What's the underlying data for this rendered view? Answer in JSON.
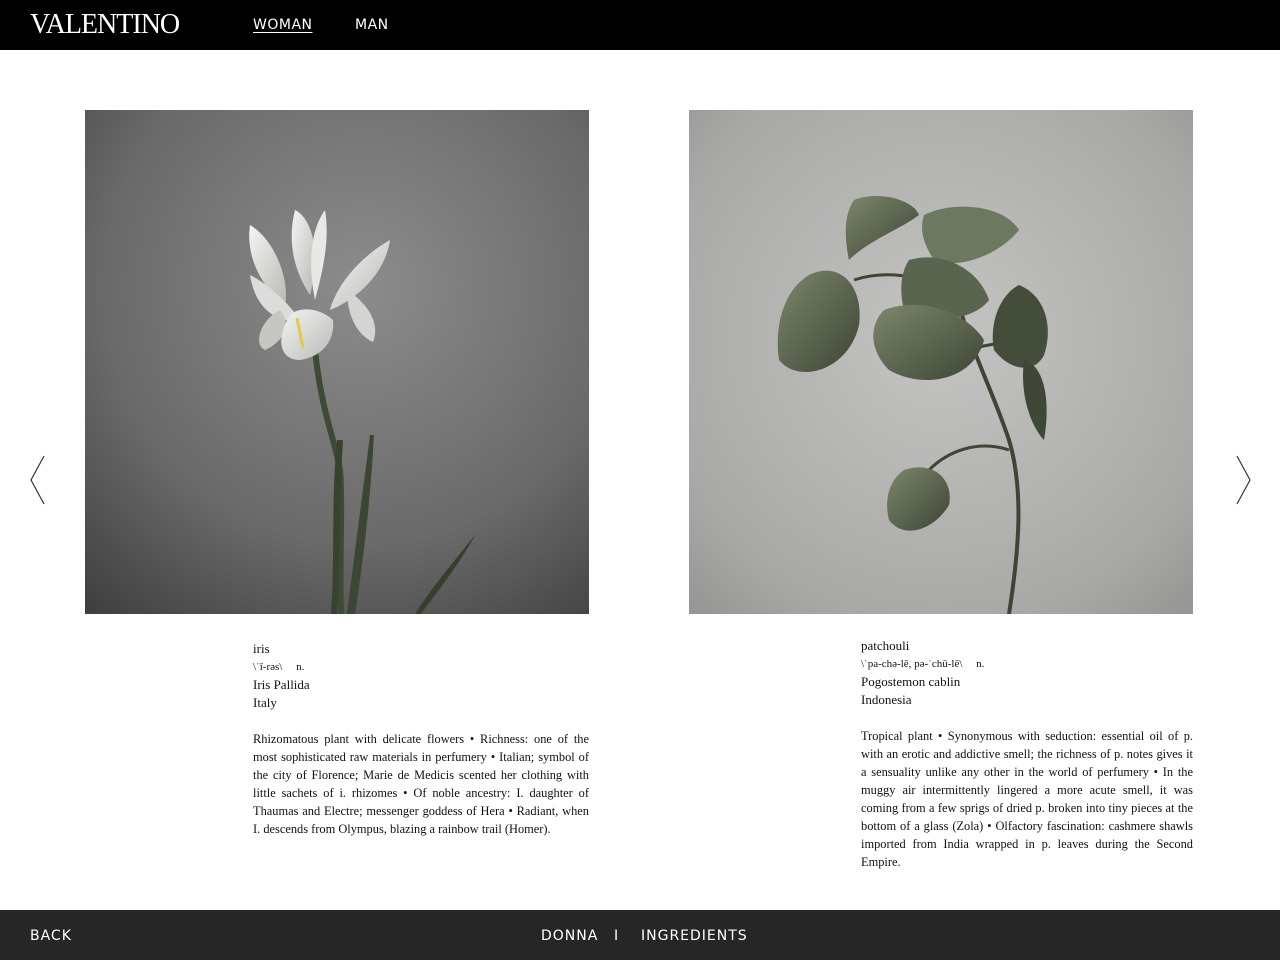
{
  "header": {
    "logo": "VALENTINO",
    "nav": {
      "woman": "WOMAN",
      "man": "MAN"
    }
  },
  "carousel": {
    "prev_icon": "chevron-left-icon",
    "next_icon": "chevron-right-icon"
  },
  "ingredients": [
    {
      "name": "iris",
      "phonetic": "\\ˈī-rəs\\",
      "pos": "n.",
      "latin": "Iris Pallida",
      "origin": "Italy",
      "description": "Rhizomatous plant with delicate flowers   •   Richness: one of the most sophisticated raw materials in perfumery   •   Italian; symbol of the city of Florence; Marie de Medicis scented her clothing with little sachets of i. rhizomes   •   Of noble ancestry: I. daughter of Thaumas and Electre; messenger goddess of Hera   •   Radiant, when I. descends from Olympus, blazing a rainbow trail (Homer)."
    },
    {
      "name": "patchouli",
      "phonetic": "\\ˈpa-chə-lē, pə-ˈchü-lē\\",
      "pos": "n.",
      "latin": "Pogostemon cablin",
      "origin": "Indonesia",
      "description": "Tropical plant   •   Synonymous with seduction: essential oil of p. with an erotic and addictive smell; the richness of p. notes gives it a sensuality unlike any other in the world of perfumery   •   In the muggy air intermittently lingered a more acute smell, it was coming from a few sprigs of dried p. broken into tiny pieces at the bottom of a glass (Zola)   •   Olfactory fascination: cashmere shawls imported from India wrapped in p. leaves during the Second Empire."
    }
  ],
  "footer": {
    "back": "BACK",
    "donna": "DONNA",
    "separator": "I",
    "ingredients": "INGREDIENTS"
  },
  "colors": {
    "header_bg": "#000000",
    "footer_bg": "#262626",
    "page_bg": "#ffffff"
  }
}
